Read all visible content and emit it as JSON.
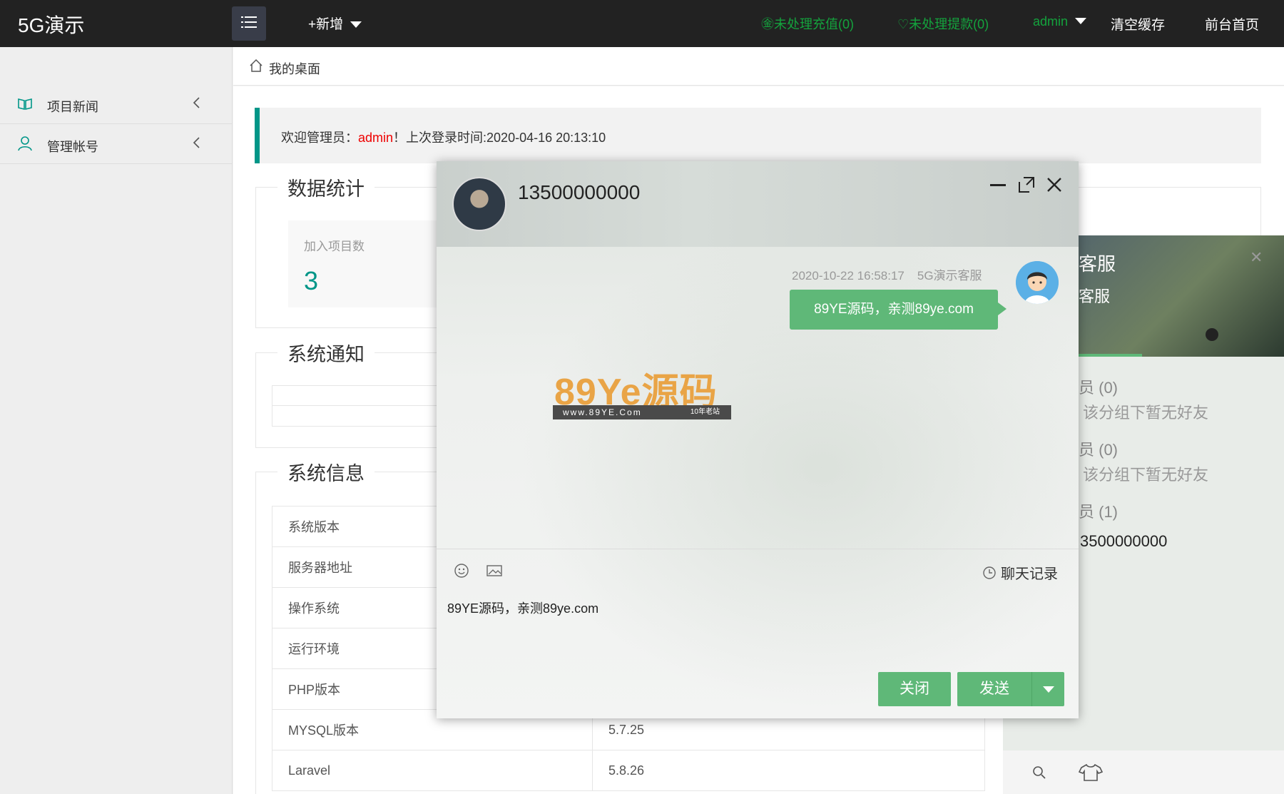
{
  "header": {
    "logo": "5G演示",
    "add_new": "+新增",
    "pending_recharge": "㊎未处理充值(0)",
    "pending_withdraw": "♡未处理提款(0)",
    "user": "admin",
    "clear_cache": "清空缓存",
    "front_home": "前台首页"
  },
  "sidebar": {
    "items": [
      {
        "label": "项目新闻",
        "icon": "book-icon"
      },
      {
        "label": "管理帐号",
        "icon": "user-icon"
      }
    ]
  },
  "breadcrumb": {
    "label": "我的桌面"
  },
  "welcome": {
    "prefix": "欢迎管理员：",
    "name": "admin",
    "suffix": "！上次登录时间:2020-04-16 20:13:10"
  },
  "sections": {
    "stats": "数据统计",
    "notice": "系统通知",
    "info": "系统信息"
  },
  "stats": {
    "label": "加入项目数",
    "value": "3"
  },
  "system_info": [
    {
      "key": "系统版本",
      "value": ""
    },
    {
      "key": "服务器地址",
      "value": ""
    },
    {
      "key": "操作系统",
      "value": ""
    },
    {
      "key": "运行环境",
      "value": ""
    },
    {
      "key": "PHP版本",
      "value": ""
    },
    {
      "key": "MYSQL版本",
      "value": "5.7.25"
    },
    {
      "key": "Laravel",
      "value": "5.8.26"
    }
  ],
  "friend_panel": {
    "title": "客服",
    "subtitle": "客服",
    "groups": [
      {
        "label": "员 (0)",
        "empty": "该分组下暂无好友"
      },
      {
        "label": "员 (0)",
        "empty": "该分组下暂无好友"
      },
      {
        "label": "员 (1)"
      }
    ],
    "user": "3500000000"
  },
  "chat": {
    "title": "13500000000",
    "message": {
      "time": "2020-10-22 16:58:17",
      "sender": "5G演示客服",
      "text": "89YE源码，亲测89ye.com"
    },
    "watermark": {
      "brand": "89Ye源码",
      "site": "www.89YE.Com",
      "tag": "10年老站"
    },
    "history": "聊天记录",
    "input_value": "89YE源码，亲测89ye.com",
    "close": "关闭",
    "send": "发送"
  },
  "colors": {
    "accent": "#5fb878",
    "teal": "#009688",
    "topbar": "#222222",
    "green_text": "#14a33d"
  }
}
